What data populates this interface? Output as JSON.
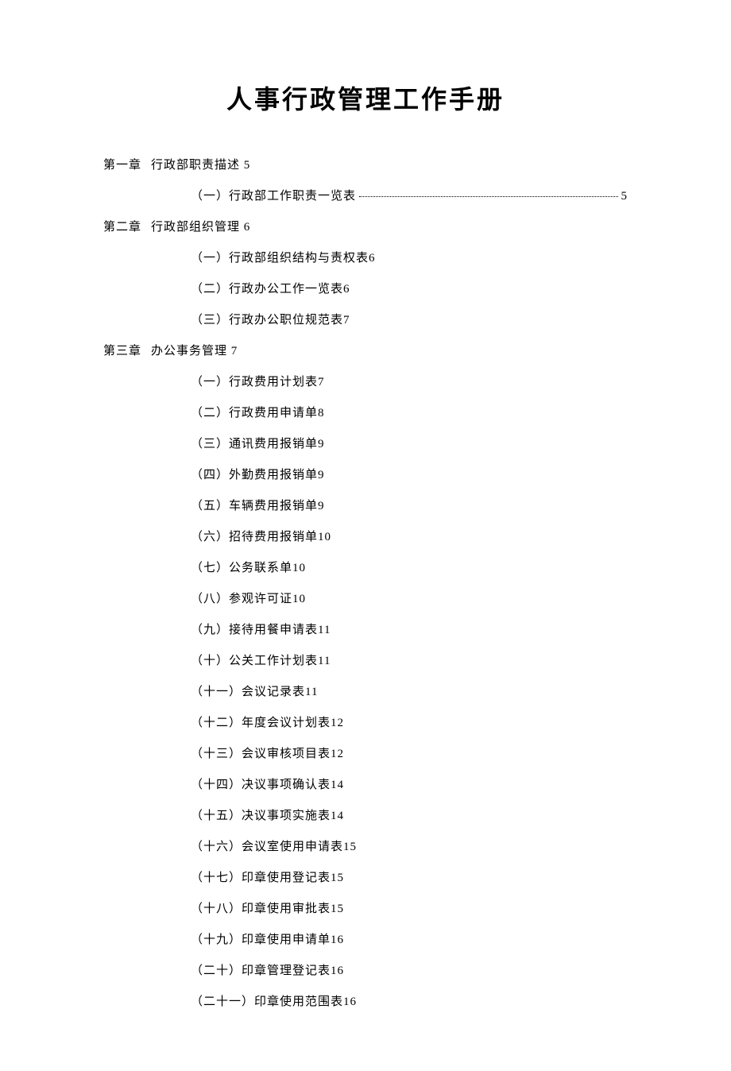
{
  "title": "人事行政管理工作手册",
  "chapters": [
    {
      "label": "第一章",
      "heading": "行政部职责描述",
      "page": "5",
      "items": [
        {
          "text": "（一）行政部工作职责一览表",
          "page": "5",
          "dotted": true
        }
      ]
    },
    {
      "label": "第二章",
      "heading": "行政部组织管理",
      "page": "6",
      "items": [
        {
          "text": "（一）行政部组织结构与责权表",
          "page": "6",
          "dotted": false
        },
        {
          "text": "（二）行政办公工作一览表",
          "page": "6",
          "dotted": false
        },
        {
          "text": "（三）行政办公职位规范表",
          "page": "7",
          "dotted": false
        }
      ]
    },
    {
      "label": "第三章",
      "heading": "办公事务管理",
      "page": "7",
      "items": [
        {
          "text": "（一）行政费用计划表",
          "page": "7",
          "dotted": false
        },
        {
          "text": "（二）行政费用申请单",
          "page": "8",
          "dotted": false
        },
        {
          "text": "（三）通讯费用报销单",
          "page": "9",
          "dotted": false
        },
        {
          "text": "（四）外勤费用报销单",
          "page": "9",
          "dotted": false
        },
        {
          "text": "（五）车辆费用报销单",
          "page": "9",
          "dotted": false
        },
        {
          "text": "（六）招待费用报销单",
          "page": "10",
          "dotted": false
        },
        {
          "text": "（七）公务联系单",
          "page": "10",
          "dotted": false
        },
        {
          "text": "（八）参观许可证",
          "page": "10",
          "dotted": false
        },
        {
          "text": "（九）接待用餐申请表",
          "page": "11",
          "dotted": false
        },
        {
          "text": "（十）公关工作计划表",
          "page": "11",
          "dotted": false
        },
        {
          "text": "（十一）会议记录表",
          "page": "11",
          "dotted": false
        },
        {
          "text": "（十二）年度会议计划表",
          "page": "12",
          "dotted": false
        },
        {
          "text": "（十三）会议审核项目表",
          "page": "12",
          "dotted": false
        },
        {
          "text": "（十四）决议事项确认表",
          "page": "14",
          "dotted": false
        },
        {
          "text": "（十五）决议事项实施表",
          "page": "14",
          "dotted": false
        },
        {
          "text": "（十六）会议室使用申请表",
          "page": "15",
          "dotted": false
        },
        {
          "text": "（十七）印章使用登记表",
          "page": "15",
          "dotted": false
        },
        {
          "text": "（十八）印章使用审批表",
          "page": "15",
          "dotted": false
        },
        {
          "text": "（十九）印章使用申请单",
          "page": "16",
          "dotted": false
        },
        {
          "text": "（二十）印章管理登记表",
          "page": "16",
          "dotted": false
        },
        {
          "text": "（二十一）印章使用范围表",
          "page": "16",
          "dotted": false
        }
      ]
    }
  ]
}
